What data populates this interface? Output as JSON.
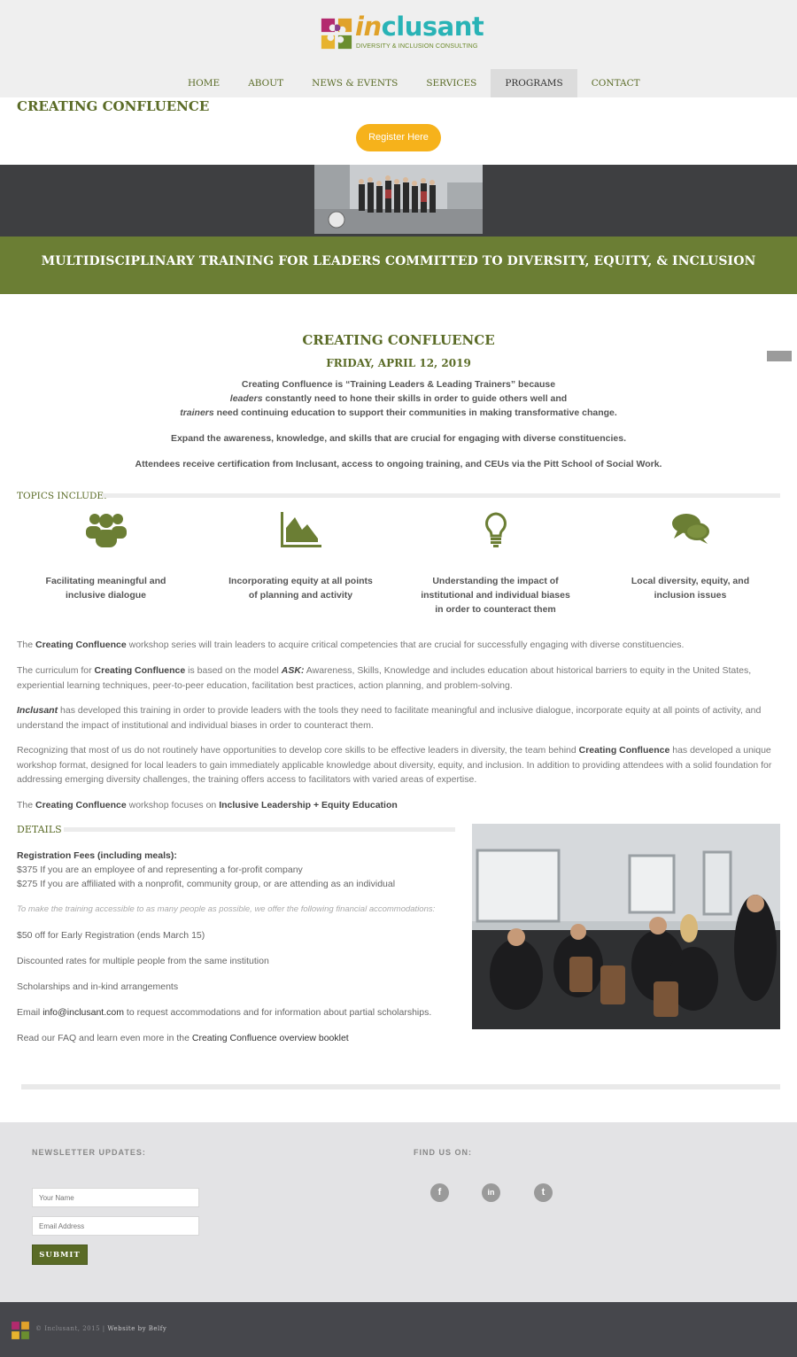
{
  "header": {
    "logo_word_prefix": "in",
    "logo_word_suffix": "clusant",
    "logo_tagline": "DIVERSITY & INCLUSION CONSULTING",
    "nav": [
      "HOME",
      "ABOUT",
      "NEWS & EVENTS",
      "SERVICES",
      "PROGRAMS",
      "CONTACT"
    ],
    "active_nav": "PROGRAMS",
    "accent_color": "#5a6b26"
  },
  "page_title": "CREATING CONFLUENCE",
  "register_label": "Register Here",
  "band_title": "MULTIDISCIPLINARY TRAINING FOR LEADERS COMMITTED TO DIVERSITY, EQUITY, & INCLUSION",
  "intro": {
    "title": "CREATING CONFLUENCE",
    "date": "FRIDAY, APRIL 12, 2019",
    "line1": "Creating Confluence is “Training Leaders & Leading Trainers” because",
    "line2_em": "leaders",
    "line2_rest": " constantly need to hone their skills in order to guide others well and",
    "line3_em": "trainers",
    "line3_rest": " need continuing education to support their communities in making transformative change.",
    "line4": "Expand the awareness, knowledge, and skills that are crucial for engaging with diverse constituencies.",
    "line5": "Attendees receive certification from Inclusant, access to ongoing training, and CEUs via the Pitt School of Social Work."
  },
  "topics": {
    "heading": "TOPICS INCLUDE:",
    "items": [
      {
        "icon": "group-icon",
        "label": "Facilitating meaningful and inclusive dialogue"
      },
      {
        "icon": "area-chart-icon",
        "label": "Incorporating equity at all points of planning and activity"
      },
      {
        "icon": "lightbulb-icon",
        "label": "Understanding the impact of institutional and individual biases in order to counteract them"
      },
      {
        "icon": "chat-bubbles-icon",
        "label": "Local diversity, equity, and inclusion issues"
      }
    ]
  },
  "body": {
    "p1_a": "The ",
    "p1_b": "Creating Confluence",
    "p1_c": " workshop series will train leaders to acquire critical competencies that are crucial for successfully engaging with diverse constituencies.",
    "p2_a": "The curriculum for ",
    "p2_b": "Creating Confluence",
    "p2_c": " is based on the model ",
    "p2_d": "ASK:",
    "p2_e": " Awareness, Skills, Knowledge and includes education about historical barriers to equity in the United States, experiential learning techniques, peer-to-peer education, facilitation best practices, action planning, and problem-solving.",
    "p3_a": "Inclusant",
    "p3_b": " has developed this training in order to provide leaders with the tools they need to facilitate meaningful and inclusive dialogue, incorporate equity at all points of activity, and understand the impact of institutional and individual biases in order to counteract them.",
    "p4_a": "Recognizing that most of us do not routinely have opportunities to develop core skills to be effective leaders in diversity, the team behind ",
    "p4_b": "Creating Confluence",
    "p4_c": " has developed a unique workshop format, designed for local leaders to gain immediately applicable knowledge about diversity, equity, and inclusion. In addition to providing attendees with a solid foundation for addressing emerging diversity challenges, the training offers access to facilitators with varied areas of expertise.",
    "p5_a": "The ",
    "p5_b": "Creating Confluence",
    "p5_c": " workshop focuses on ",
    "p5_d": "Inclusive Leadership + Equity Education"
  },
  "details": {
    "heading": "DETAILS",
    "fees_title": "Registration Fees (including meals):",
    "fee1": "$375  If you are an employee of and representing a for-profit company",
    "fee2": "$275  If you are affiliated with a nonprofit, community group, or are attending as an individual",
    "accommodations_note": "To make the training accessible to as many people as possible, we offer the following financial accommodations:",
    "offer1": "$50 off for Early Registration (ends March 15)",
    "offer2": "Discounted rates for multiple people from the same institution",
    "offer3": "Scholarships and in-kind arrangements",
    "email_a": "Email ",
    "email_link": "info@inclusant.com",
    "email_b": " to request accommodations and for information about partial scholarships.",
    "faq_a": "Read our FAQ and learn even more in the ",
    "faq_link": "Creating Confluence overview booklet"
  },
  "footer": {
    "newsletter_heading": "NEWSLETTER UPDATES:",
    "name_placeholder": "Your Name",
    "email_placeholder": "Email Address",
    "submit_label": "SUBMIT",
    "find_heading": "FIND US ON:",
    "social": [
      {
        "icon": "facebook-icon",
        "glyph": "f"
      },
      {
        "icon": "linkedin-icon",
        "glyph": "in"
      },
      {
        "icon": "twitter-icon",
        "glyph": "t"
      }
    ],
    "copyright": "© Inclusant, 2015 | ",
    "credit": "Website by Belfy"
  }
}
